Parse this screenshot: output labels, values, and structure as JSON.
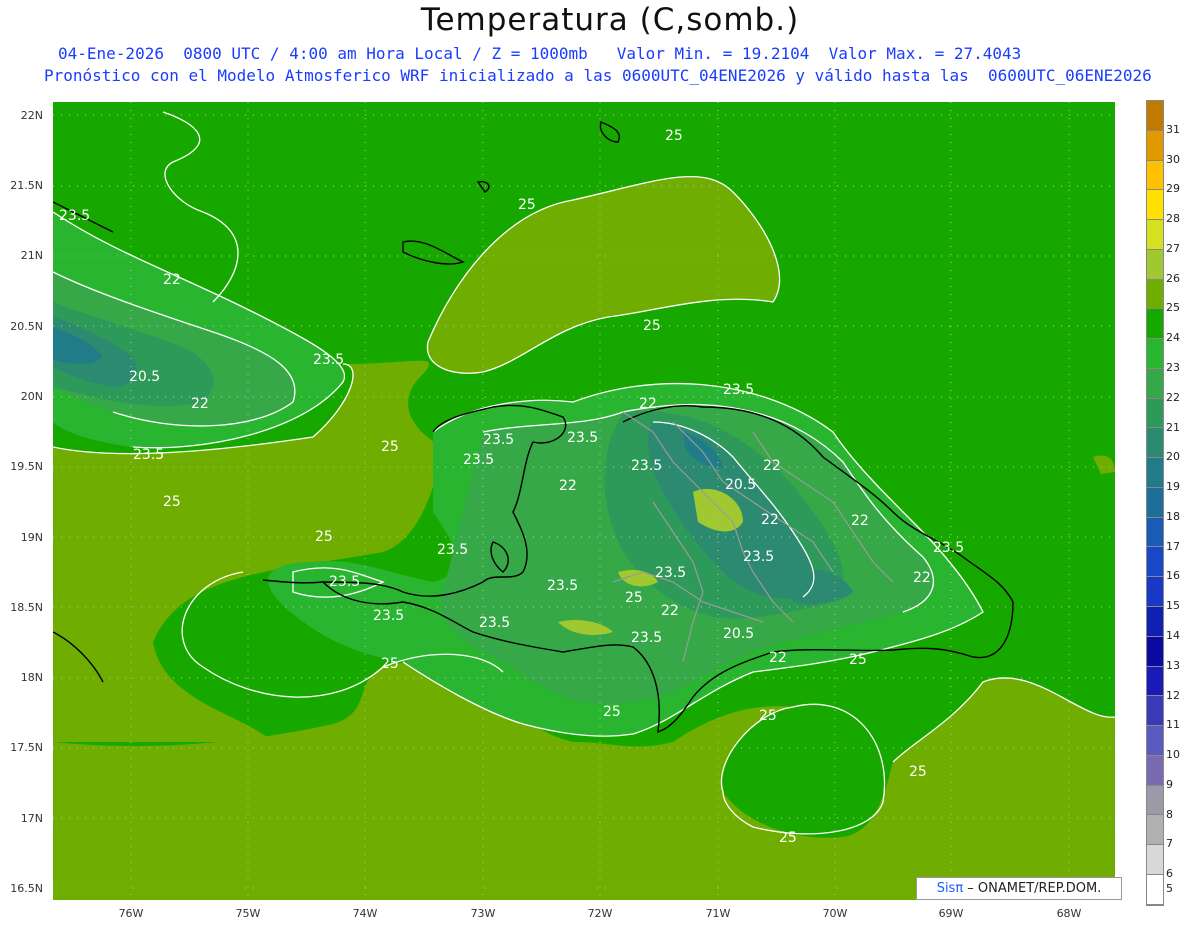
{
  "header": {
    "title": "Temperatura (C,somb.)",
    "line1": "04-Ene-2026  0800 UTC / 4:00 am Hora Local / Z = 1000mb   Valor Min. = 19.2104  Valor Max. = 27.4043",
    "line2": "Pronóstico con el Modelo Atmosferico WRF inicializado a las 0600UTC_04ENE2026 y válido hasta las  0600UTC_06ENE2026"
  },
  "axes": {
    "lat_labels": [
      "22N",
      "21.5N",
      "21N",
      "20.5N",
      "20N",
      "19.5N",
      "19N",
      "18.5N",
      "18N",
      "17.5N",
      "17N",
      "16.5N"
    ],
    "lon_labels": [
      "76W",
      "75W",
      "74W",
      "73W",
      "72W",
      "71W",
      "70W",
      "69W",
      "68W"
    ]
  },
  "colorbar": {
    "labels": [
      "31",
      "30",
      "29",
      "28",
      "27",
      "26",
      "25",
      "24",
      "23",
      "22",
      "21",
      "20",
      "19",
      "18",
      "17",
      "16",
      "15",
      "14",
      "13",
      "12",
      "11",
      "10",
      "9",
      "8",
      "7",
      "6",
      "5"
    ],
    "colors": [
      "#c07a00",
      "#e09a00",
      "#ffc000",
      "#ffe000",
      "#d4e020",
      "#a0c830",
      "#6fae00",
      "#17a800",
      "#2ab530",
      "#36a848",
      "#2d9a5a",
      "#2b8a70",
      "#1f7c88",
      "#1d6e9a",
      "#1a5cb4",
      "#1848c8",
      "#1838c8",
      "#1020b0",
      "#0a0aa0",
      "#1a1ab8",
      "#3a3ab8",
      "#5a5ac0",
      "#7a6ab0",
      "#9a9aa8",
      "#b0b0b0",
      "#d8d8d8",
      "#ffffff"
    ]
  },
  "contour_labels": [
    "25",
    "25",
    "25",
    "25",
    "25",
    "25",
    "25",
    "25",
    "25",
    "25",
    "25",
    "25",
    "25",
    "23.5",
    "23.5",
    "23.5",
    "23.5",
    "23.5",
    "23.5",
    "23.5",
    "23.5",
    "23.5",
    "23.5",
    "23.5",
    "23.5",
    "23.5",
    "23.5",
    "23.5",
    "23.5",
    "23.5",
    "22",
    "22",
    "22",
    "22",
    "22",
    "22",
    "22",
    "22",
    "22",
    "22",
    "20.5",
    "20.5",
    "20.5"
  ],
  "credit": {
    "sis": "Sisπ",
    "text": " – ONAMET/REP.DOM."
  }
}
